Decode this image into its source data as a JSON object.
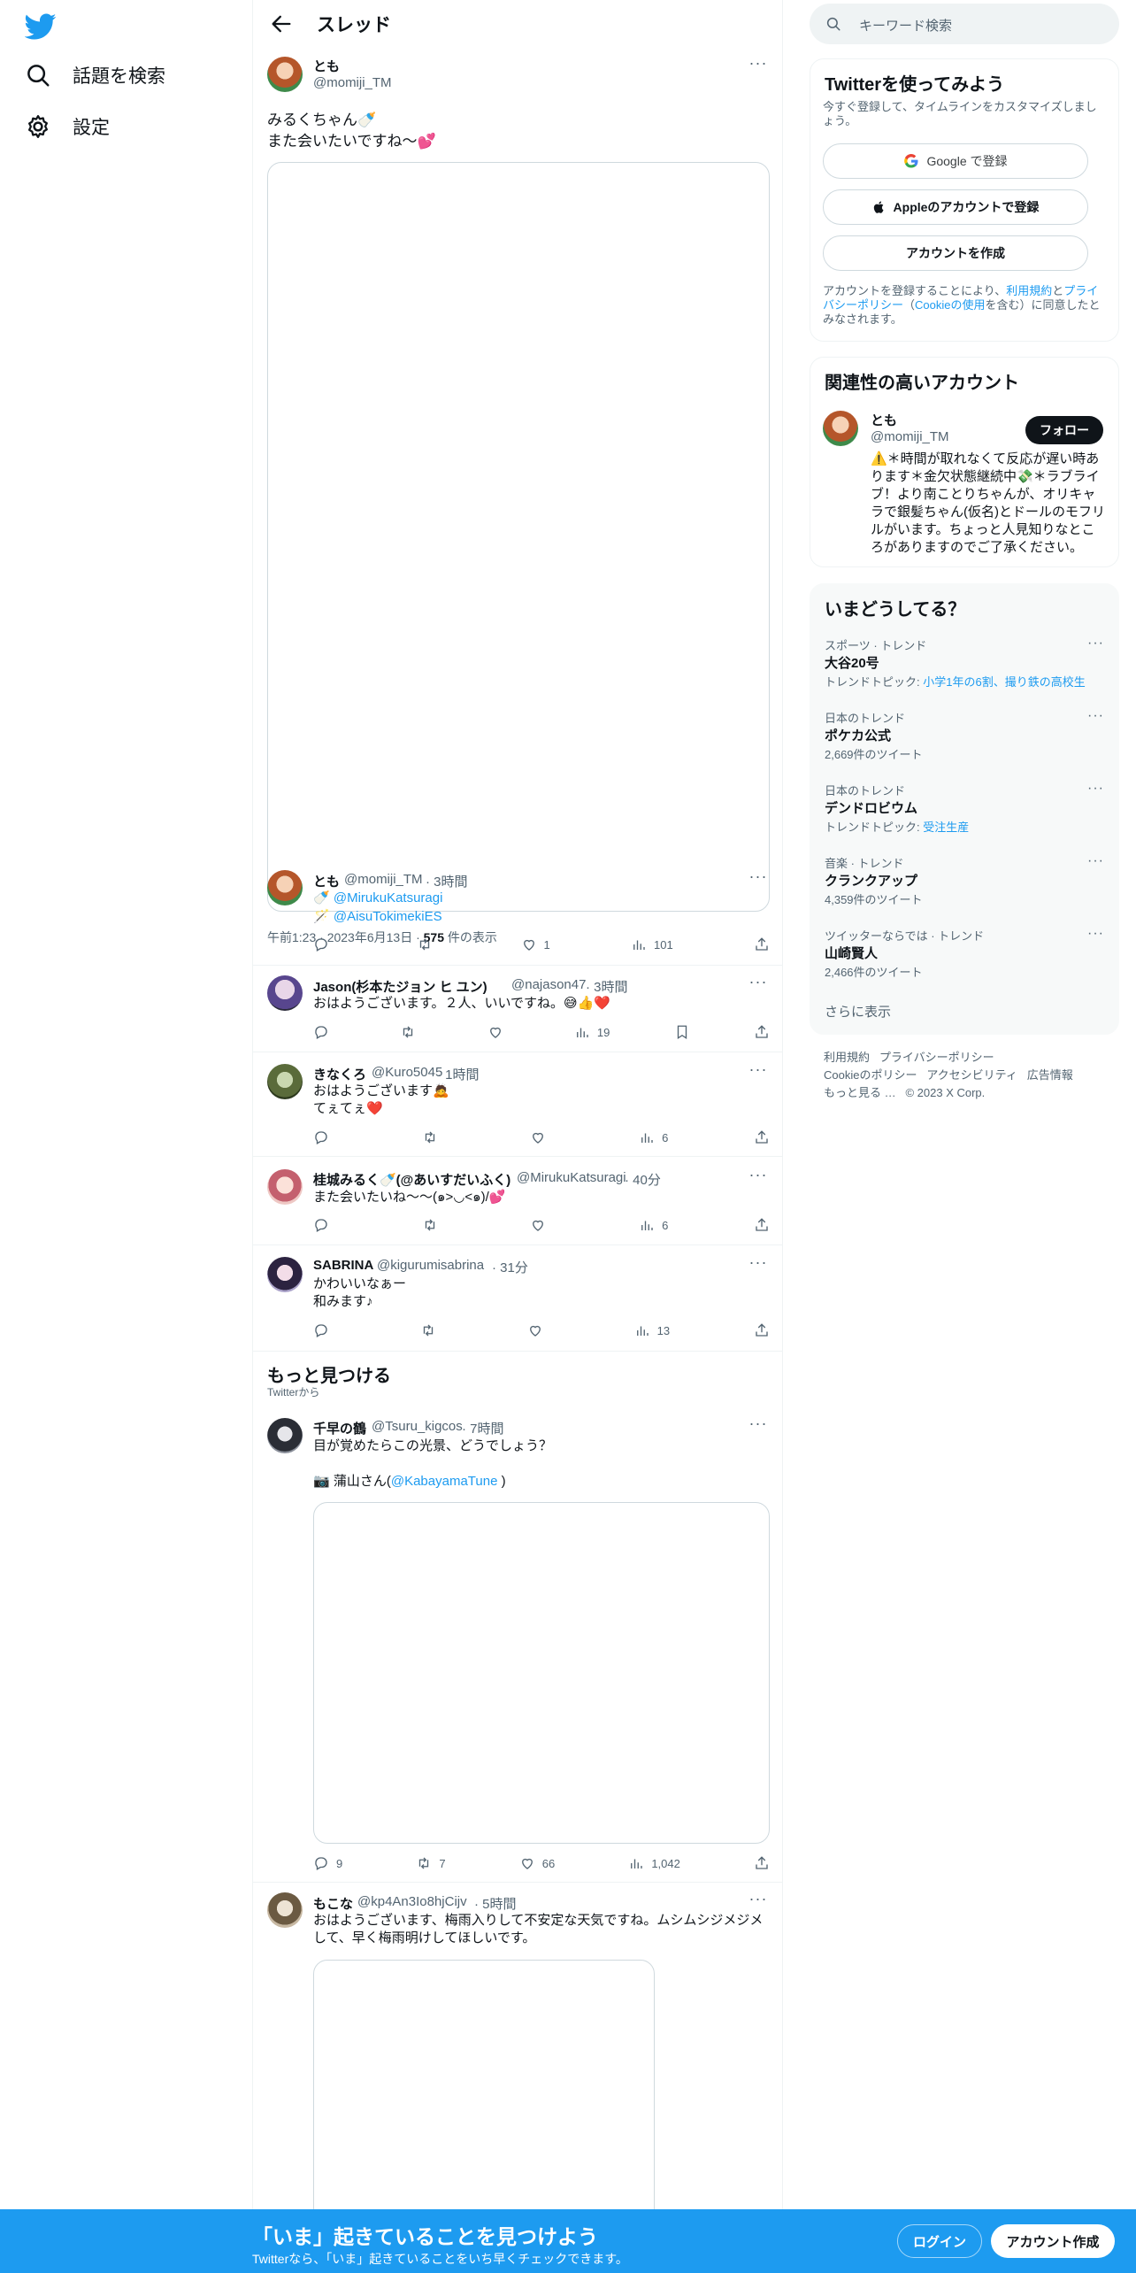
{
  "nav": {
    "items": [
      {
        "label": "話題を検索",
        "icon": "search-icon"
      },
      {
        "label": "設定",
        "icon": "gear-icon"
      }
    ]
  },
  "header": {
    "title": "スレッド"
  },
  "main_tweet": {
    "name": "とも",
    "handle": "@momiji_TM",
    "text": "みるくちゃん🍼\nまた会いたいですね〜💕",
    "timestamp": "午前1:23 · 2023年6月13日 · ",
    "views_count": "575",
    "views_label": " 件の表示"
  },
  "overlay_reply": {
    "name": "とも",
    "handle": "@momiji_TM",
    "time": "· 3時間",
    "mention_1": "🍼 @MirukuKatsuragi",
    "mention_2": "🪄 @AisuTokimekiES",
    "stats": {
      "reply": "",
      "retweet": "",
      "like": "1",
      "views": "101"
    }
  },
  "replies": [
    {
      "name": "Jason(杉本たジョン ヒ ユン)",
      "handle": "@najason47",
      "time": "· 3時間",
      "text": "おはようございます。２人、いいですね。😅👍❤️",
      "stats": {
        "reply": "",
        "retweet": "",
        "like": "",
        "views": "19"
      }
    },
    {
      "name": "きなくろ",
      "handle": "@Kuro5045",
      "time": "· 1時間",
      "text": "おはようございます🙇\nてぇてぇ❤️",
      "stats": {
        "reply": "",
        "retweet": "",
        "like": "",
        "views": "6"
      }
    },
    {
      "name": "桂城みるく🍼(@あいすだいふく)",
      "handle": "@MirukuKatsuragi",
      "time": "· 40分",
      "text": "また会いたいね〜〜(๑>◡<๑)/💕",
      "stats": {
        "reply": "",
        "retweet": "",
        "like": "",
        "views": "6"
      }
    },
    {
      "name": "SABRINA",
      "handle": "@kigurumisabrina",
      "time": "· 31分",
      "text": "かわいいなぁー\n和みます♪",
      "stats": {
        "reply": "",
        "retweet": "",
        "like": "",
        "views": "13"
      }
    }
  ],
  "discover": {
    "title": "もっと見つける",
    "sub": "Twitterから",
    "tweets": [
      {
        "name": "千早の鶴",
        "handle": "@Tsuru_kigcos",
        "time": "· 7時間",
        "text": "目が覚めたらこの光景、どうでしょう？",
        "credit_prefix": "📷 蒲山さん(",
        "credit_link": "@KabayamaTune",
        "credit_suffix": " )",
        "stats": {
          "reply": "9",
          "retweet": "7",
          "like": "66",
          "views": "1,042"
        }
      },
      {
        "name": "もこな",
        "handle": "@kp4An3Io8hjCijv",
        "time": "· 5時間",
        "text": "おはようございます、梅雨入りして不安定な天気ですね。ムシムシジメジメして、早く梅雨明けしてほしいです。"
      }
    ]
  },
  "search": {
    "placeholder": "キーワード検索"
  },
  "signup_card": {
    "title": "Twitterを使ってみよう",
    "sub": "今すぐ登録して、タイムラインをカスタマイズしましょう。",
    "google": "Google で登録",
    "apple": "Appleのアカウントで登録",
    "create": "アカウントを作成",
    "legal_1": "アカウントを登録することにより、",
    "legal_terms": "利用規約",
    "legal_2": "と",
    "legal_privacy": "プライバシーポリシー",
    "legal_3": "（",
    "legal_cookie": "Cookieの使用",
    "legal_4": "を含む）に同意したとみなされます。"
  },
  "related_card": {
    "title": "関連性の高いアカウント",
    "name": "とも",
    "handle": "@momiji_TM",
    "follow": "フォロー",
    "bio": "⚠️＊時間が取れなくて反応が遅い時あります＊金欠状態継続中💸＊ラブライブ！より南ことりちゃんが、オリキャラで銀髪ちゃん(仮名)とドールのモフリルがいます。ちょっと人見知りなところがありますのでご了承ください。"
  },
  "trends_card": {
    "title": "いまどうしてる？",
    "items": [
      {
        "category": "スポーツ · トレンド",
        "name": "大谷20号",
        "sub_prefix": "トレンドトピック: ",
        "sub_link": "小学1年の6割、撮り鉄の高校生"
      },
      {
        "category": "日本のトレンド",
        "name": "ポケカ公式",
        "sub_prefix": "2,669件のツイート",
        "sub_link": ""
      },
      {
        "category": "日本のトレンド",
        "name": "デンドロビウム",
        "sub_prefix": "トレンドトピック: ",
        "sub_link": "受注生産"
      },
      {
        "category": "音楽 · トレンド",
        "name": "クランクアップ",
        "sub_prefix": "4,359件のツイート",
        "sub_link": ""
      },
      {
        "category": "ツイッターならでは · トレンド",
        "name": "山崎賢人",
        "sub_prefix": "2,466件のツイート",
        "sub_link": ""
      }
    ],
    "show_more": "さらに表示"
  },
  "footer": {
    "links": [
      "利用規約",
      "プライバシーポリシー",
      "Cookieのポリシー",
      "アクセシビリティ",
      "広告情報",
      "もっと見る …",
      "© 2023 X Corp."
    ]
  },
  "bottom_bar": {
    "title": "「いま」起きていることを見つけよう",
    "sub": "Twitterなら、「いま」起きていることをいち早くチェックできます。",
    "login": "ログイン",
    "signup": "アカウント作成"
  },
  "colors": {
    "accent": "#1d9bf0",
    "text": "#0f1419",
    "muted": "#536471",
    "border": "#eff3f4"
  }
}
